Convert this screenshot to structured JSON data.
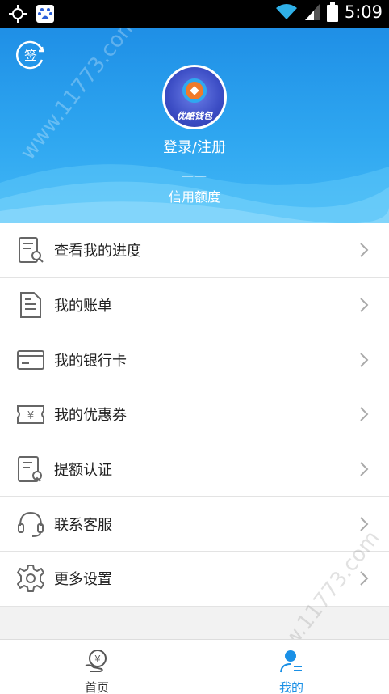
{
  "status_bar": {
    "time": "5:09"
  },
  "header": {
    "sign_label": "签",
    "avatar_brand": "优酷钱包",
    "login_label": "登录/注册",
    "credit_value": "——",
    "credit_label": "信用额度"
  },
  "menu": {
    "items": [
      {
        "label": "查看我的进度",
        "icon": "progress-doc-icon"
      },
      {
        "label": "我的账单",
        "icon": "bill-icon"
      },
      {
        "label": "我的银行卡",
        "icon": "bank-card-icon"
      },
      {
        "label": "我的优惠券",
        "icon": "coupon-icon"
      },
      {
        "label": "提额认证",
        "icon": "certify-icon"
      },
      {
        "label": "联系客服",
        "icon": "headset-icon"
      },
      {
        "label": "更多设置",
        "icon": "gear-icon"
      }
    ]
  },
  "bottom_nav": {
    "home_label": "首页",
    "mine_label": "我的",
    "active": "mine"
  },
  "watermark": "www.11773.com",
  "colors": {
    "accent": "#1a90e6",
    "header_top": "#1f8fe6",
    "header_bottom": "#43b8f6"
  }
}
